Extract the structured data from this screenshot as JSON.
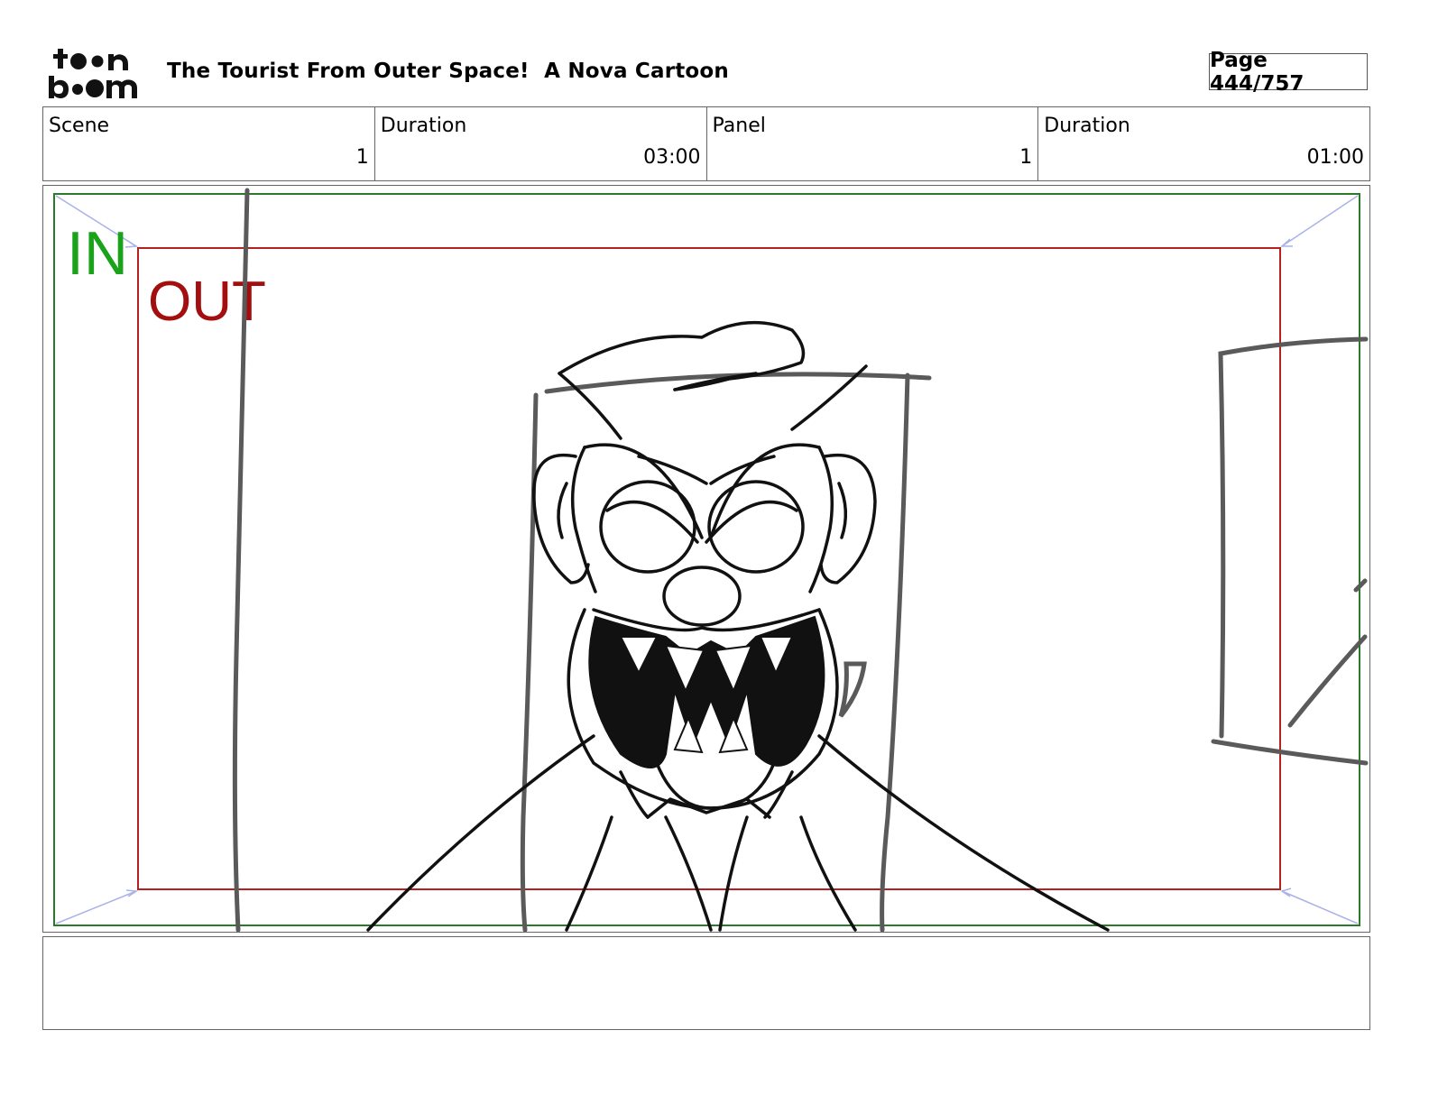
{
  "header": {
    "logo_text": "toon boom",
    "title": "The Tourist From Outer Space!  A Nova Cartoon",
    "page": "Page 444/757"
  },
  "info": {
    "scene_label": "Scene",
    "scene_value": "1",
    "scene_duration_label": "Duration",
    "scene_duration_value": "03:00",
    "panel_label": "Panel",
    "panel_value": "1",
    "panel_duration_label": "Duration",
    "panel_duration_value": "01:00"
  },
  "frame": {
    "in_label": "IN",
    "out_label": "OUT",
    "in_color": "#1aa31a",
    "out_color": "#a30f0f"
  },
  "notes": {
    "text": ""
  }
}
